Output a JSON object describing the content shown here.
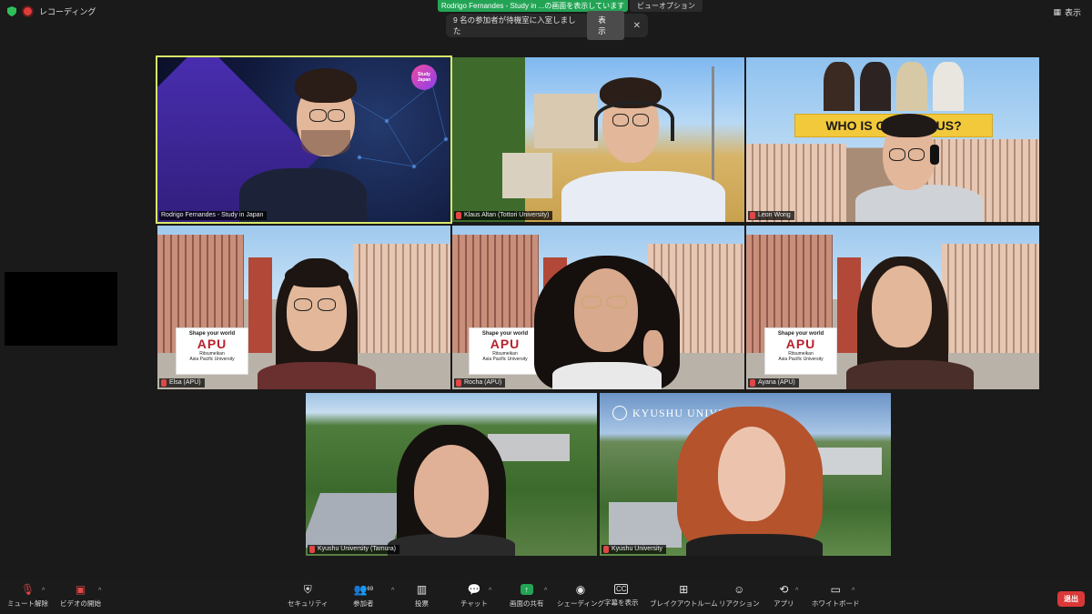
{
  "topbar": {
    "recording_label": "レコーディング",
    "share_banner": "Rodrigo Fernandes - Study in ...の画面を表示しています",
    "view_options_label": "ビューオプション",
    "view_label": "表示",
    "notification_text": "9 名の参加者が待機室に入室しました",
    "notification_button": "表示"
  },
  "tiles": [
    {
      "name": "Rodrigo Fernandes - Study in Japan",
      "logo_text": "Study Japan"
    },
    {
      "name": "Klaus Altan (Tottori University)"
    },
    {
      "name": "Leon Wong",
      "banner_text": "WHO IS ON CAMPUS?"
    },
    {
      "name": "Elsa (APU)",
      "sign": {
        "line1": "Shape your world",
        "logo": "APU",
        "line2": "Ritsumeikan",
        "line3": "Asia Pacific University"
      }
    },
    {
      "name": "Rocha (APU)",
      "sign": {
        "line1": "Shape your world",
        "logo": "APU",
        "line2": "Ritsumeikan",
        "line3": "Asia Pacific University"
      }
    },
    {
      "name": "Ayana (APU)",
      "sign": {
        "line1": "Shape your world",
        "logo": "APU",
        "line2": "Ritsumeikan",
        "line3": "Asia Pacific University"
      }
    },
    {
      "name": "Kyushu University (Tamura)"
    },
    {
      "name": "Kyushu University",
      "banner_text": "KYUSHU UNIVERSITY"
    }
  ],
  "toolbar": {
    "mute": "ミュート解除",
    "video": "ビデオの開始",
    "security": "セキュリティ",
    "participants": "参加者",
    "participants_count": "69",
    "polls": "投票",
    "chat": "チャット",
    "share": "画面の共有",
    "showing": "シェーディング",
    "captions": "字幕を表示",
    "breakout": "ブレイクアウトルーム",
    "reactions": "リアクション",
    "apps": "アプリ",
    "whiteboard": "ホワイトボード",
    "end": "退出"
  },
  "colors": {
    "active_speaker_outline": "#d9e868",
    "share_banner": "#23a455",
    "end_button": "#d93838",
    "background": "#1a1a1a"
  }
}
